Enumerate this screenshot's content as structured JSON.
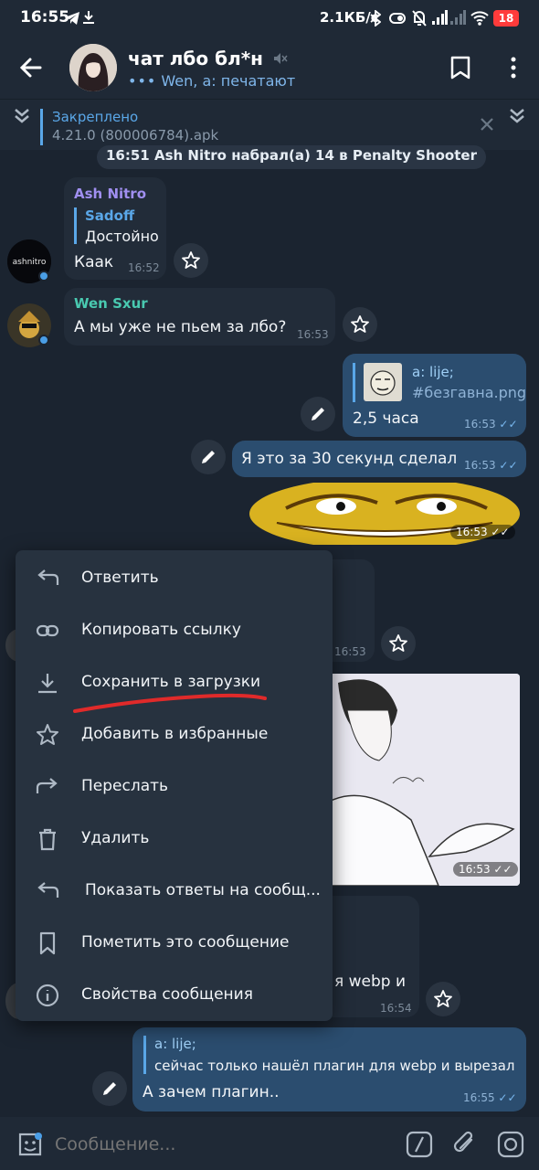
{
  "status_bar": {
    "time": "16:55",
    "network_speed": "2.1КБ/с",
    "battery": "18",
    "icons": [
      "telegram-icon",
      "download-icon",
      "bluetooth-icon",
      "vibrate-icon",
      "mute-icon",
      "signal-icon",
      "wifi-icon",
      "battery-icon"
    ]
  },
  "header": {
    "title": "чат лбо бл*н",
    "typing_status": "Wen, a: печатают",
    "icons": [
      "back-arrow-icon",
      "bookmark-icon",
      "more-vert-icon"
    ]
  },
  "pinned": {
    "label": "Закреплено",
    "text": "4.21.0 (800006784).apk"
  },
  "service_message": "16:51 Ash Nitro набрал(а) 14 в Penalty Shooter",
  "messages": [
    {
      "sender": "Ash Nitro",
      "reply_author": "Sadoff",
      "reply_text": "Достойно",
      "text": "Каак",
      "time": "16:52"
    },
    {
      "sender": "Wen Sxur",
      "text": "А мы уже не пьем за лбо?",
      "time": "16:53"
    },
    {
      "reply_author": "a: lije;",
      "reply_text": "#безгавна.png",
      "text": "2,5 часа",
      "time": "16:53"
    },
    {
      "text": "Я это за 30 секунд сделал",
      "time": "16:53"
    },
    {
      "sticker": "smiley-face",
      "time": "16:53"
    },
    {
      "time": "16:53"
    },
    {
      "image": "manga-drawing",
      "time": "16:53"
    },
    {
      "text": "я webp и",
      "time": "16:54"
    },
    {
      "reply_author": "a: lije;",
      "reply_text": "сейчас только нашёл плагин для webp и вырезал",
      "text": "А зачем плагин..",
      "time": "16:55"
    }
  ],
  "context_menu": [
    {
      "label": "Ответить",
      "icon": "reply-icon"
    },
    {
      "label": "Копировать ссылку",
      "icon": "link-icon"
    },
    {
      "label": "Сохранить в загрузки",
      "icon": "download-icon"
    },
    {
      "label": "Добавить в избранные",
      "icon": "star-icon"
    },
    {
      "label": "Переслать",
      "icon": "forward-icon"
    },
    {
      "label": "Удалить",
      "icon": "trash-icon"
    },
    {
      "label": "Показать ответы на сообщ...",
      "icon": "reply-icon"
    },
    {
      "label": "Пометить это сообщение",
      "icon": "bookmark-icon"
    },
    {
      "label": "Свойства сообщения",
      "icon": "info-icon"
    }
  ],
  "input": {
    "placeholder": "Сообщение..."
  },
  "colors": {
    "background": "#1b2430",
    "accent": "#5aa7e8",
    "outgoing": "#2b4d6f",
    "incoming": "#222c39",
    "menu": "#27323f",
    "underline": "#e02a2a"
  }
}
